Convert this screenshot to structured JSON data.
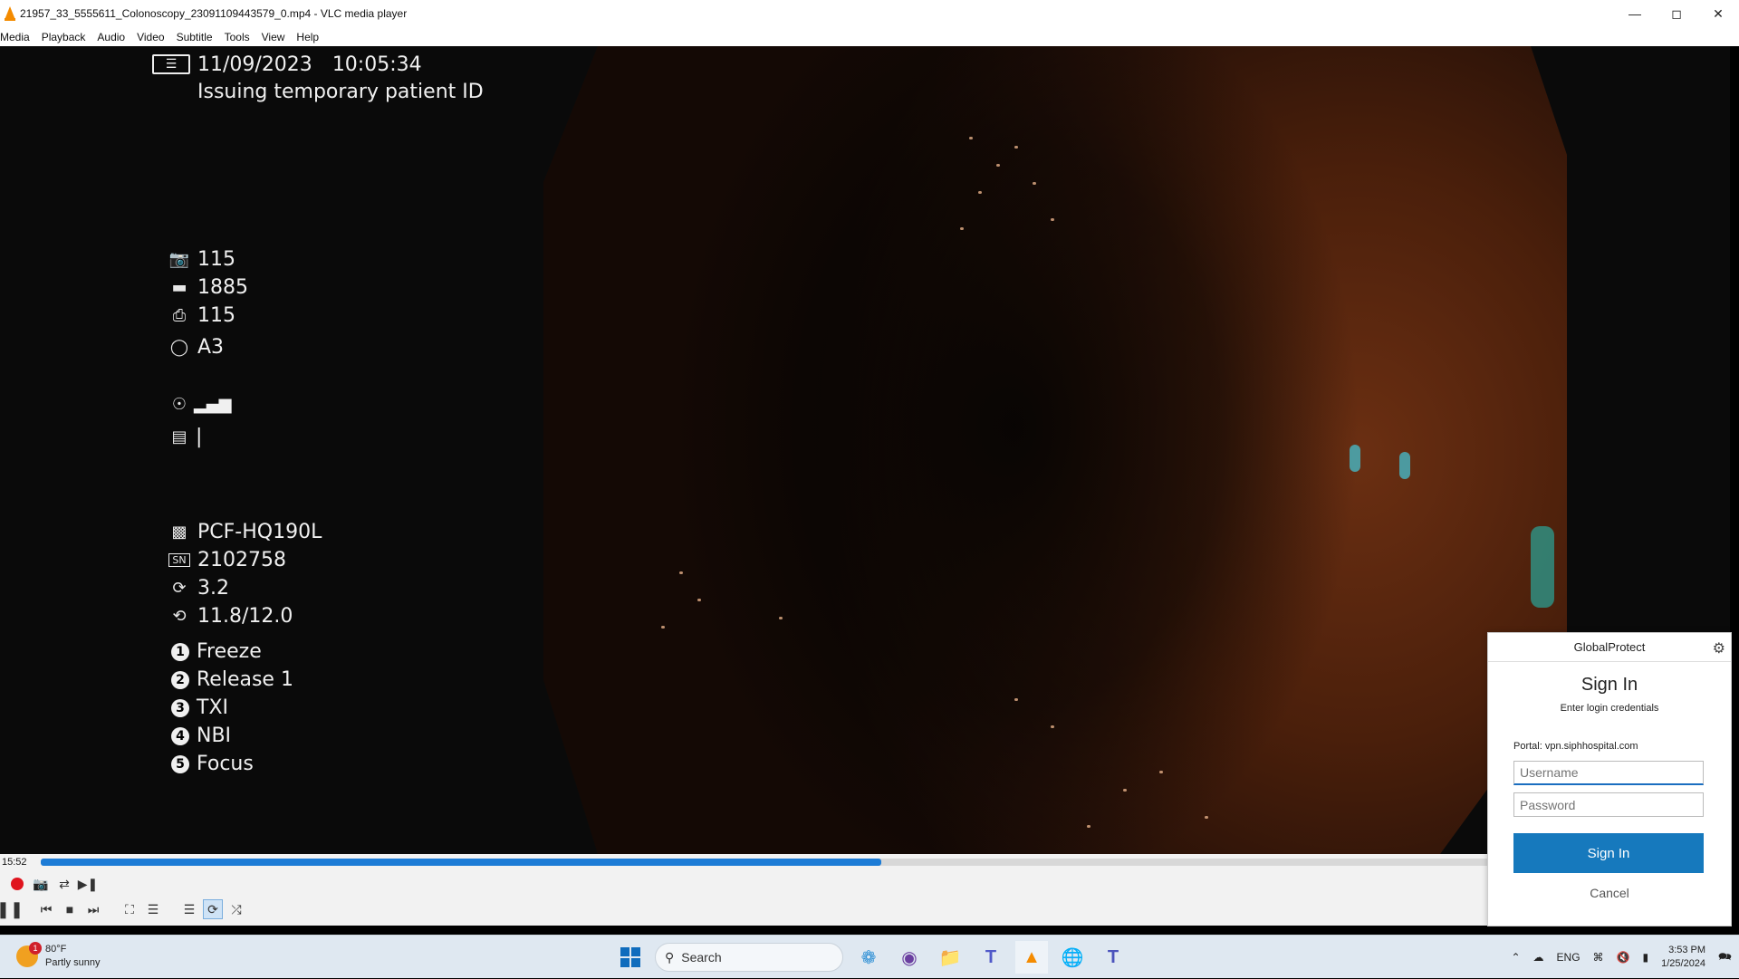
{
  "window": {
    "title": "21957_33_5555611_Colonoscopy_23091109443579_0.mp4 - VLC media player",
    "controls": [
      "minimize-icon",
      "maximize-icon",
      "close-icon"
    ]
  },
  "menu": [
    "Media",
    "Playback",
    "Audio",
    "Video",
    "Subtitle",
    "Tools",
    "View",
    "Help"
  ],
  "osd": {
    "date": "11/09/2023",
    "time": "10:05:34",
    "status": "Issuing temporary patient ID",
    "camera_count": "115",
    "battery_count": "1885",
    "cvp_count": "115",
    "mode": "A3",
    "scope_model": "PCF-HQ190L",
    "serial": "2102758",
    "value_a": "3.2",
    "value_b": "11.8/12.0",
    "buttons": [
      {
        "num": "1",
        "label": "Freeze"
      },
      {
        "num": "2",
        "label": "Release 1"
      },
      {
        "num": "3",
        "label": "TXI"
      },
      {
        "num": "4",
        "label": "NBI"
      },
      {
        "num": "5",
        "label": "Focus"
      }
    ]
  },
  "player": {
    "elapsed": "15:52",
    "progress_fraction": 0.58
  },
  "globalprotect": {
    "header": "GlobalProtect",
    "title": "Sign In",
    "subtitle": "Enter login credentials",
    "portal": "Portal: vpn.siphhospital.com",
    "username_placeholder": "Username",
    "password_placeholder": "Password",
    "signin_label": "Sign In",
    "cancel_label": "Cancel"
  },
  "taskbar": {
    "weather_temp": "80°F",
    "weather_desc": "Partly sunny",
    "weather_badge": "1",
    "search_label": "Search",
    "language": "ENG",
    "clock_time": "3:53 PM",
    "clock_date": "1/25/2024"
  }
}
